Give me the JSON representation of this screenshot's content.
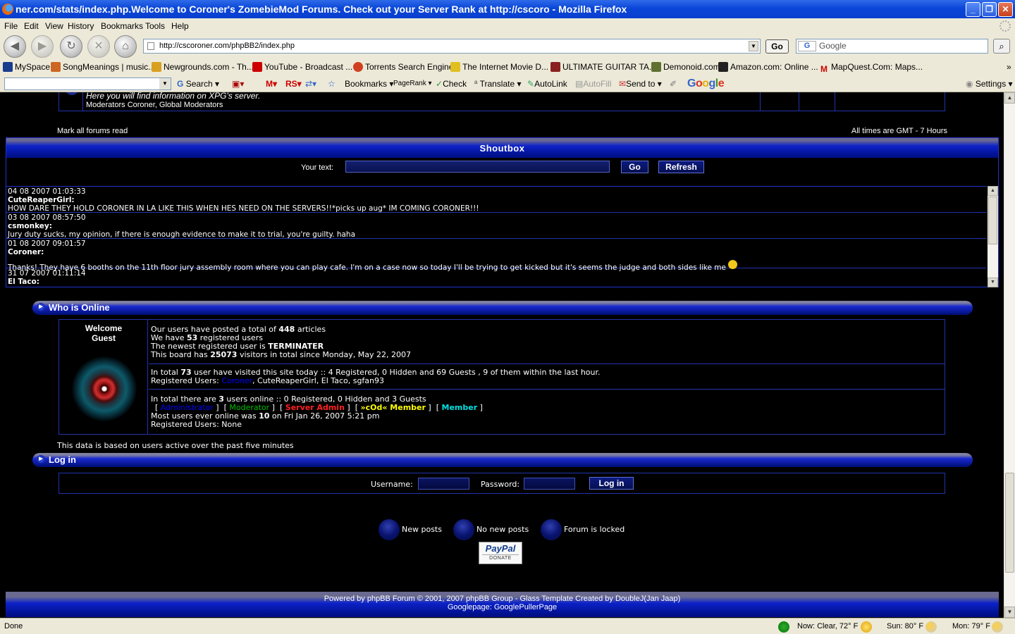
{
  "window": {
    "title": "ner.com/stats/index.php.Welcome to Coroner's ZomebieMod Forums. Check out your Server Rank at http://cscoro - Mozilla Firefox"
  },
  "menu": [
    "File",
    "Edit",
    "View",
    "History",
    "Bookmarks",
    "Tools",
    "Help"
  ],
  "nav": {
    "url": "http://cscoroner.com/phpBB2/index.php",
    "go_label": "Go",
    "search_placeholder": "Google",
    "search_engine": "G"
  },
  "bookmarks": [
    "MySpace",
    "SongMeanings | music...",
    "Newgrounds.com - Th...",
    "YouTube - Broadcast ...",
    "Torrents Search Engine",
    "The Internet Movie D...",
    "ULTIMATE GUITAR TA...",
    "Demonoid.com",
    "Amazon.com: Online ...",
    "MapQuest.Com: Maps..."
  ],
  "google_toolbar": {
    "search": "Search",
    "rs": "RS",
    "bookmarks": "Bookmarks",
    "pagerank": "PageRank",
    "check": "Check",
    "translate": "Translate",
    "autolink": "AutoLink",
    "autofill": "AutoFill",
    "sendto": "Send to",
    "brand": "Google",
    "settings": "Settings"
  },
  "forum_row": {
    "description": "Here you will find information on XPG's server.",
    "moderators": "Moderators Coroner, Global Moderators"
  },
  "mark_all": "Mark all forums read",
  "timezone": "All times are GMT - 7 Hours",
  "shoutbox": {
    "title": "Shoutbox",
    "your_text": "Your text:",
    "go": "Go",
    "refresh": "Refresh",
    "messages": [
      {
        "time": "04 08 2007 01:03:33",
        "user": "CuteReaperGirl:",
        "text": "HOW DARE THEY HOLD CORONER IN LA LIKE THIS WHEN HES NEED ON THE SERVERS!!*picks up aug* IM COMING CORONER!!!"
      },
      {
        "time": "03 08 2007 08:57:50",
        "user": "csmonkey:",
        "text": "Jury duty sucks, my opinion, if there is enough evidence to make it to trial, you're guilty. haha"
      },
      {
        "time": "01 08 2007 09:01:57",
        "user": "Coroner:",
        "text": "Thanks! They have 6 booths on the 11th floor jury assembly room where you can play cafe. I'm on a case now so today I'll be trying to get kicked but it's seems the judge and both sides like me"
      },
      {
        "time": "31 07 2007 01:11:14",
        "user": "El Taco:",
        "text": ""
      }
    ]
  },
  "who_online": {
    "header": "Who is Online",
    "welcome": "Welcome",
    "guest": "Guest",
    "stats1": {
      "l1a": "Our users have posted a total of ",
      "articles": "448",
      "l1b": " articles",
      "l2a": "We have ",
      "users": "53",
      "l2b": " registered users",
      "l3a": "The newest registered user is ",
      "newest": "TERMINATER",
      "l4a": "This board has ",
      "visitors": "25073",
      "l4b": " visitors in total since Monday, May 22, 2007"
    },
    "stats2": {
      "l1a": "In total ",
      "today": "73",
      "l1b": " user have visited this site today :: 4 Registered, 0 Hidden and 69 Guests , 9 of them within the last hour.",
      "l2a": "Registered Users: ",
      "u1": "Coroner",
      "u2": ", CuteReaperGirl, El Taco, sgfan93"
    },
    "stats3": {
      "l1a": "In total there are ",
      "online": "3",
      "l1b": " users online :: 0 Registered, 0 Hidden and 3 Guests",
      "roles": [
        "Administrator",
        "Moderator",
        "Server Admin",
        "»cOd« Member",
        "Member"
      ],
      "l3a": "Most users ever online was ",
      "most": "10",
      "l3b": " on Fri Jan 26, 2007 5:21 pm",
      "l4": "Registered Users: None"
    },
    "note": "This data is based on users active over the past five minutes"
  },
  "login": {
    "header": "Log in",
    "username": "Username:",
    "password": "Password:",
    "button": "Log in"
  },
  "legend": {
    "new": "New posts",
    "none": "No new posts",
    "locked": "Forum is locked"
  },
  "paypal": {
    "brand": "PayPal",
    "donate": "DONATE"
  },
  "footer": {
    "line1": "Powered by phpBB Forum © 2001, 2007 phpBB Group - Glass Template Created by DoubleJ(Jan Jaap)",
    "line2": "Googlepage: GooglePullerPage"
  },
  "status": {
    "text": "Done",
    "now": "Now: Clear, 72° F",
    "sun": "Sun: 80° F",
    "mon": "Mon: 79° F"
  },
  "colors": {
    "admin": "#0000ff",
    "moderator": "#00c000",
    "server_admin": "#ff2020",
    "cod_member": "#ffff00",
    "member": "#00e0e0"
  }
}
